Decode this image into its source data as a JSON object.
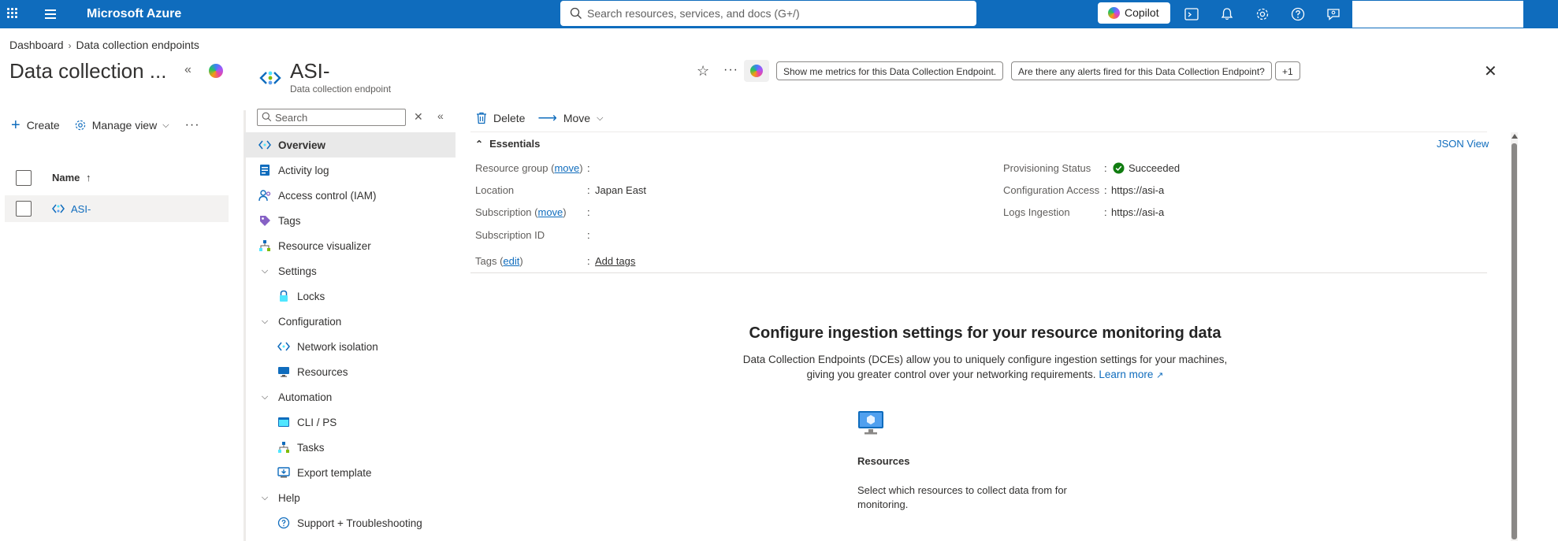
{
  "topbar": {
    "brand": "Microsoft Azure",
    "search_placeholder": "Search resources, services, and docs (G+/)",
    "copilot_label": "Copilot",
    "icons": [
      "cloud-shell-icon",
      "bell-icon",
      "gear-icon",
      "help-icon",
      "feedback-icon"
    ]
  },
  "breadcrumb": {
    "items": [
      "Dashboard",
      "Data collection endpoints"
    ]
  },
  "left_panel": {
    "title": "Data collection ...",
    "create_label": "Create",
    "manage_view_label": "Manage view",
    "column_name": "Name",
    "sort_indicator": "↑",
    "rows": [
      {
        "name": "ASI-"
      }
    ]
  },
  "blade": {
    "title": "ASI-",
    "subtitle": "Data collection endpoint",
    "prompts": [
      "Show me metrics for this Data Collection Endpoint.",
      "Are there any alerts fired for this Data Collection Endpoint?",
      "+1"
    ]
  },
  "menu": {
    "search_placeholder": "Search",
    "items": [
      {
        "label": "Overview",
        "selected": true
      },
      {
        "label": "Activity log"
      },
      {
        "label": "Access control (IAM)"
      },
      {
        "label": "Tags"
      },
      {
        "label": "Resource visualizer"
      },
      {
        "label": "Settings",
        "group": true
      },
      {
        "label": "Locks"
      },
      {
        "label": "Configuration",
        "group": true
      },
      {
        "label": "Network isolation"
      },
      {
        "label": "Resources"
      },
      {
        "label": "Automation",
        "group": true
      },
      {
        "label": "CLI / PS"
      },
      {
        "label": "Tasks"
      },
      {
        "label": "Export template"
      },
      {
        "label": "Help",
        "group": true
      },
      {
        "label": "Support + Troubleshooting"
      }
    ]
  },
  "commands": {
    "delete_label": "Delete",
    "move_label": "Move"
  },
  "essentials": {
    "title": "Essentials",
    "json_view": "JSON View",
    "left": {
      "resource_group_label": "Resource group",
      "resource_group_link": "move",
      "location_label": "Location",
      "location_value": "Japan East",
      "subscription_label": "Subscription",
      "subscription_link": "move",
      "subscription_id_label": "Subscription ID",
      "tags_label": "Tags",
      "tags_link": "edit",
      "add_tags": "Add tags"
    },
    "right": {
      "provisioning_label": "Provisioning Status",
      "provisioning_value": "Succeeded",
      "config_access_label": "Configuration Access",
      "config_access_value": "https://asi-a",
      "logs_ingestion_label": "Logs Ingestion",
      "logs_ingestion_value": "https://asi-a"
    }
  },
  "configure": {
    "title": "Configure ingestion settings for your resource monitoring data",
    "description_line1": "Data Collection Endpoints (DCEs) allow you to uniquely configure ingestion settings for your machines,",
    "description_line2": "giving you greater control over your networking requirements.",
    "learn_more": "Learn more",
    "card_title": "Resources",
    "card_description": "Select which resources to collect data from for monitoring."
  },
  "colors": {
    "azure_blue": "#0f6cbd",
    "success_green": "#107c10"
  }
}
